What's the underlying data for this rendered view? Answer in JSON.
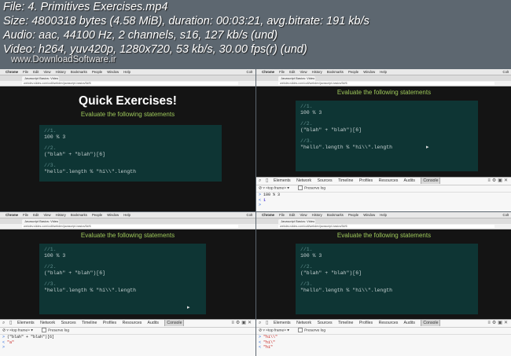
{
  "info": {
    "lines": [
      "File: 4. Primitives Exercises.mp4",
      "Size: 4800318 bytes (4.58 MiB), duration: 00:03:21, avg.bitrate: 191 kb/s",
      "Audio: aac, 44100 Hz, 2 channels, s16, 127 kb/s (und)",
      "Video: h264, yuv420p, 1280x720, 53 kb/s, 30.00 fps(r) (und)"
    ],
    "watermark": "www.DownloadSoftware.ir"
  },
  "browser": {
    "menu": [
      "Chrome",
      "File",
      "Edit",
      "View",
      "History",
      "Bookmarks",
      "People",
      "Window",
      "Help"
    ],
    "clock": "Colt",
    "tab_title": "Javascript Basics: Video",
    "url": "webdev.slides.com/colt/webdev/javascript-basics/5#/6"
  },
  "slide": {
    "title": "Quick Exercises!",
    "subtitle": "Evaluate the following statements",
    "code": [
      {
        "comment": "//1.",
        "code": "100 % 3"
      },
      {
        "comment": "//2.",
        "code": "(\"blah\" + \"blah\")[6]"
      },
      {
        "comment": "//3.",
        "code": "\"hello\".length % \"hi\\\\\".length"
      }
    ]
  },
  "devtools": {
    "tabs": [
      "Elements",
      "Network",
      "Sources",
      "Timeline",
      "Profiles",
      "Resources",
      "Audits",
      "Console"
    ],
    "active_tab": "Console",
    "frame_select": "<top frame>",
    "preserve_log": "Preserve log",
    "console_tr": [
      {
        "type": "in",
        "text": "100 % 3"
      },
      {
        "type": "out",
        "text": "1"
      }
    ],
    "console_bl": [
      {
        "type": "in",
        "text": "(\"blah\" + \"blah\")[6]"
      },
      {
        "type": "out",
        "text": "\"a\""
      }
    ],
    "console_br": [
      {
        "type": "in",
        "text": "\"hi\\\\\""
      },
      {
        "type": "out",
        "text": "\"hi\\\""
      },
      {
        "type": "out",
        "text": "\"hi\""
      }
    ]
  }
}
